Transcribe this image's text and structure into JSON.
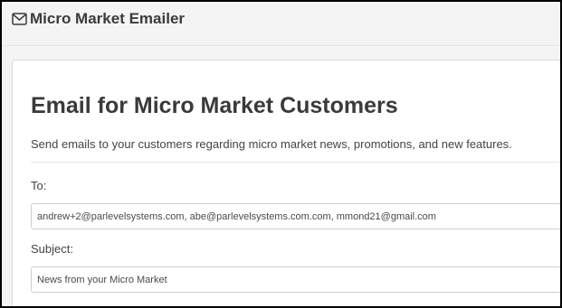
{
  "header": {
    "icon": "envelope-icon",
    "title": "Micro Market Emailer"
  },
  "form": {
    "heading": "Email for Micro Market Customers",
    "description": "Send emails to your customers regarding micro market news, promotions, and new features.",
    "to_label": "To:",
    "to_value": "andrew+2@parlevelsystems.com, abe@parlevelsystems.com.com, mmond21@gmail.com",
    "subject_label": "Subject:",
    "subject_value": "News from your Micro Market"
  }
}
